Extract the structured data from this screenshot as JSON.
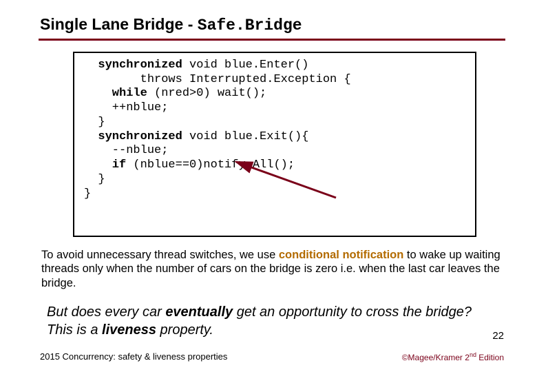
{
  "title_prefix": "Single Lane Bridge - ",
  "title_mono": "Safe.Bridge",
  "code": {
    "l1a": "  synchronized",
    "l1b": " void blue.Enter()",
    "l2": "        throws Interrupted.Exception {",
    "l3a": "    while",
    "l3b": " (nred>0) wait();",
    "l4": "    ++nblue;",
    "l5": "  }",
    "l6a": "  synchronized",
    "l6b": " void blue.Exit(){",
    "l7": "    --nblue;",
    "l8a": "    if",
    "l8b": " (nblue==0)notify.All();",
    "l9": "  }",
    "l10": "}"
  },
  "para_before": "To avoid unnecessary thread switches, we use ",
  "para_hl": "conditional notification",
  "para_after": " to wake up waiting threads only when the number of cars on the bridge is zero i.e. when the last car leaves the bridge.",
  "q1": "But does every car ",
  "q_kw1": "eventually",
  "q2": " get an opportunity to cross the bridge? This is a ",
  "q_kw2": "liveness",
  "q3": " property.",
  "slide_number": "22",
  "footer_left": "2015  Concurrency: safety & liveness properties",
  "footer_right_pre": "©Magee/Kramer ",
  "footer_right_ord": "2",
  "footer_right_sup": "nd",
  "footer_right_post": " Edition"
}
